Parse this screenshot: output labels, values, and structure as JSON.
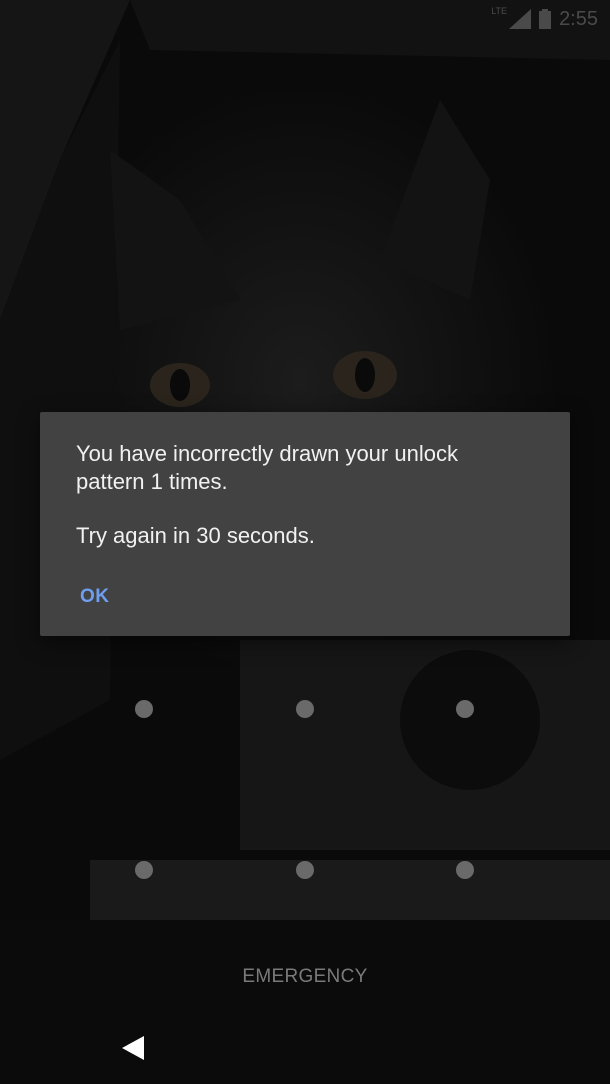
{
  "status_bar": {
    "network_label": "LTE",
    "time": "2:55",
    "icons": [
      "signal-icon",
      "battery-icon"
    ]
  },
  "dialog": {
    "message": "You have incorrectly drawn your unlock pattern 1 times.",
    "sub_message": "Try again in 30 seconds.",
    "ok_label": "OK"
  },
  "pattern": {
    "visible_dots": 6
  },
  "footer": {
    "emergency_label": "EMERGENCY"
  },
  "nav": {
    "icons": [
      "back-icon"
    ]
  },
  "colors": {
    "dialog_bg": "#424242",
    "accent": "#6f9ef0",
    "dot": "#6a6a6a"
  }
}
